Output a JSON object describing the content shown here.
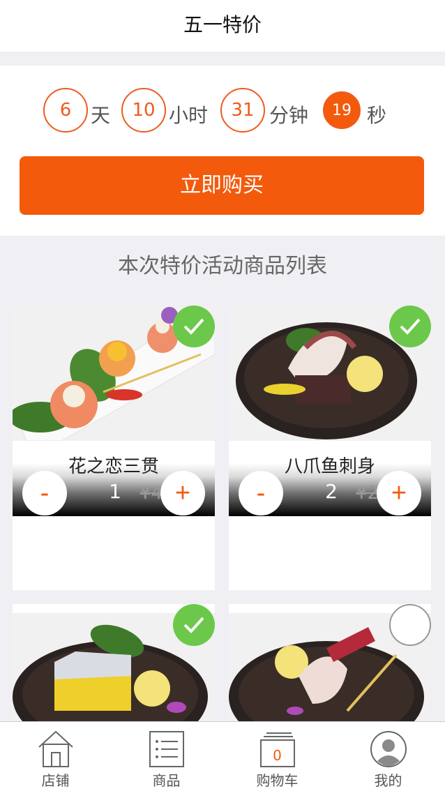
{
  "nav": {
    "title": "五一特价"
  },
  "countdown": {
    "days": "6",
    "days_unit": "天",
    "hours": "10",
    "hours_unit": "小时",
    "minutes": "31",
    "minutes_unit": "分钟",
    "seconds": "19",
    "seconds_unit": "秒"
  },
  "buy_button": "立即购买",
  "section_title": "本次特价活动商品列表",
  "products": [
    {
      "name": "花之恋三贯",
      "qty": "1",
      "price": "¥4",
      "minus": "-",
      "plus": "+",
      "checked": true
    },
    {
      "name": "八爪鱼刺身",
      "qty": "2",
      "price": "¥2",
      "minus": "-",
      "plus": "+",
      "checked": true
    },
    {
      "checked": true
    },
    {
      "checked": false
    }
  ],
  "tabbar": {
    "items": [
      {
        "label": "店铺",
        "icon": "store-icon"
      },
      {
        "label": "商品",
        "icon": "list-icon"
      },
      {
        "label": "购物车",
        "icon": "cart-icon",
        "badge": "0"
      },
      {
        "label": "我的",
        "icon": "user-icon"
      }
    ]
  },
  "colors": {
    "accent": "#f35a0b",
    "check": "#6cc84a",
    "background": "#f0eff4"
  }
}
